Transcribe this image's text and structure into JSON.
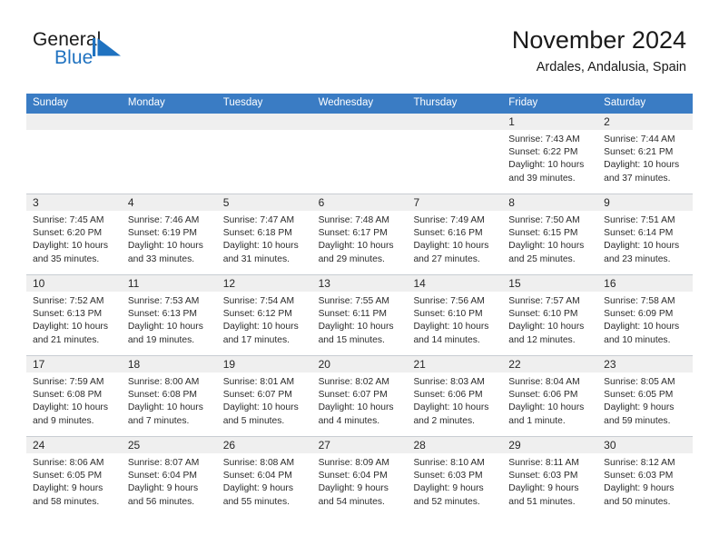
{
  "brand": {
    "line1": "General",
    "line2": "Blue",
    "mark_color": "#1f72c0",
    "text_color": "#1a1a1a",
    "blue_text_color": "#1f72c0"
  },
  "header": {
    "title": "November 2024",
    "subtitle": "Ardales, Andalusia, Spain",
    "accent_color": "#3a7cc4",
    "band_color": "#efefef"
  },
  "weekdays": [
    "Sunday",
    "Monday",
    "Tuesday",
    "Wednesday",
    "Thursday",
    "Friday",
    "Saturday"
  ],
  "labels": {
    "sunrise": "Sunrise:",
    "sunset": "Sunset:",
    "daylight": "Daylight:"
  },
  "weeks": [
    [
      {
        "day": "",
        "sunrise": "",
        "sunset": "",
        "daylight_a": "",
        "daylight_b": "",
        "empty": true
      },
      {
        "day": "",
        "sunrise": "",
        "sunset": "",
        "daylight_a": "",
        "daylight_b": "",
        "empty": true
      },
      {
        "day": "",
        "sunrise": "",
        "sunset": "",
        "daylight_a": "",
        "daylight_b": "",
        "empty": true
      },
      {
        "day": "",
        "sunrise": "",
        "sunset": "",
        "daylight_a": "",
        "daylight_b": "",
        "empty": true
      },
      {
        "day": "",
        "sunrise": "",
        "sunset": "",
        "daylight_a": "",
        "daylight_b": "",
        "empty": true
      },
      {
        "day": "1",
        "sunrise": "Sunrise: 7:43 AM",
        "sunset": "Sunset: 6:22 PM",
        "daylight_a": "Daylight: 10 hours",
        "daylight_b": "and 39 minutes.",
        "empty": false
      },
      {
        "day": "2",
        "sunrise": "Sunrise: 7:44 AM",
        "sunset": "Sunset: 6:21 PM",
        "daylight_a": "Daylight: 10 hours",
        "daylight_b": "and 37 minutes.",
        "empty": false
      }
    ],
    [
      {
        "day": "3",
        "sunrise": "Sunrise: 7:45 AM",
        "sunset": "Sunset: 6:20 PM",
        "daylight_a": "Daylight: 10 hours",
        "daylight_b": "and 35 minutes.",
        "empty": false
      },
      {
        "day": "4",
        "sunrise": "Sunrise: 7:46 AM",
        "sunset": "Sunset: 6:19 PM",
        "daylight_a": "Daylight: 10 hours",
        "daylight_b": "and 33 minutes.",
        "empty": false
      },
      {
        "day": "5",
        "sunrise": "Sunrise: 7:47 AM",
        "sunset": "Sunset: 6:18 PM",
        "daylight_a": "Daylight: 10 hours",
        "daylight_b": "and 31 minutes.",
        "empty": false
      },
      {
        "day": "6",
        "sunrise": "Sunrise: 7:48 AM",
        "sunset": "Sunset: 6:17 PM",
        "daylight_a": "Daylight: 10 hours",
        "daylight_b": "and 29 minutes.",
        "empty": false
      },
      {
        "day": "7",
        "sunrise": "Sunrise: 7:49 AM",
        "sunset": "Sunset: 6:16 PM",
        "daylight_a": "Daylight: 10 hours",
        "daylight_b": "and 27 minutes.",
        "empty": false
      },
      {
        "day": "8",
        "sunrise": "Sunrise: 7:50 AM",
        "sunset": "Sunset: 6:15 PM",
        "daylight_a": "Daylight: 10 hours",
        "daylight_b": "and 25 minutes.",
        "empty": false
      },
      {
        "day": "9",
        "sunrise": "Sunrise: 7:51 AM",
        "sunset": "Sunset: 6:14 PM",
        "daylight_a": "Daylight: 10 hours",
        "daylight_b": "and 23 minutes.",
        "empty": false
      }
    ],
    [
      {
        "day": "10",
        "sunrise": "Sunrise: 7:52 AM",
        "sunset": "Sunset: 6:13 PM",
        "daylight_a": "Daylight: 10 hours",
        "daylight_b": "and 21 minutes.",
        "empty": false
      },
      {
        "day": "11",
        "sunrise": "Sunrise: 7:53 AM",
        "sunset": "Sunset: 6:13 PM",
        "daylight_a": "Daylight: 10 hours",
        "daylight_b": "and 19 minutes.",
        "empty": false
      },
      {
        "day": "12",
        "sunrise": "Sunrise: 7:54 AM",
        "sunset": "Sunset: 6:12 PM",
        "daylight_a": "Daylight: 10 hours",
        "daylight_b": "and 17 minutes.",
        "empty": false
      },
      {
        "day": "13",
        "sunrise": "Sunrise: 7:55 AM",
        "sunset": "Sunset: 6:11 PM",
        "daylight_a": "Daylight: 10 hours",
        "daylight_b": "and 15 minutes.",
        "empty": false
      },
      {
        "day": "14",
        "sunrise": "Sunrise: 7:56 AM",
        "sunset": "Sunset: 6:10 PM",
        "daylight_a": "Daylight: 10 hours",
        "daylight_b": "and 14 minutes.",
        "empty": false
      },
      {
        "day": "15",
        "sunrise": "Sunrise: 7:57 AM",
        "sunset": "Sunset: 6:10 PM",
        "daylight_a": "Daylight: 10 hours",
        "daylight_b": "and 12 minutes.",
        "empty": false
      },
      {
        "day": "16",
        "sunrise": "Sunrise: 7:58 AM",
        "sunset": "Sunset: 6:09 PM",
        "daylight_a": "Daylight: 10 hours",
        "daylight_b": "and 10 minutes.",
        "empty": false
      }
    ],
    [
      {
        "day": "17",
        "sunrise": "Sunrise: 7:59 AM",
        "sunset": "Sunset: 6:08 PM",
        "daylight_a": "Daylight: 10 hours",
        "daylight_b": "and 9 minutes.",
        "empty": false
      },
      {
        "day": "18",
        "sunrise": "Sunrise: 8:00 AM",
        "sunset": "Sunset: 6:08 PM",
        "daylight_a": "Daylight: 10 hours",
        "daylight_b": "and 7 minutes.",
        "empty": false
      },
      {
        "day": "19",
        "sunrise": "Sunrise: 8:01 AM",
        "sunset": "Sunset: 6:07 PM",
        "daylight_a": "Daylight: 10 hours",
        "daylight_b": "and 5 minutes.",
        "empty": false
      },
      {
        "day": "20",
        "sunrise": "Sunrise: 8:02 AM",
        "sunset": "Sunset: 6:07 PM",
        "daylight_a": "Daylight: 10 hours",
        "daylight_b": "and 4 minutes.",
        "empty": false
      },
      {
        "day": "21",
        "sunrise": "Sunrise: 8:03 AM",
        "sunset": "Sunset: 6:06 PM",
        "daylight_a": "Daylight: 10 hours",
        "daylight_b": "and 2 minutes.",
        "empty": false
      },
      {
        "day": "22",
        "sunrise": "Sunrise: 8:04 AM",
        "sunset": "Sunset: 6:06 PM",
        "daylight_a": "Daylight: 10 hours",
        "daylight_b": "and 1 minute.",
        "empty": false
      },
      {
        "day": "23",
        "sunrise": "Sunrise: 8:05 AM",
        "sunset": "Sunset: 6:05 PM",
        "daylight_a": "Daylight: 9 hours",
        "daylight_b": "and 59 minutes.",
        "empty": false
      }
    ],
    [
      {
        "day": "24",
        "sunrise": "Sunrise: 8:06 AM",
        "sunset": "Sunset: 6:05 PM",
        "daylight_a": "Daylight: 9 hours",
        "daylight_b": "and 58 minutes.",
        "empty": false
      },
      {
        "day": "25",
        "sunrise": "Sunrise: 8:07 AM",
        "sunset": "Sunset: 6:04 PM",
        "daylight_a": "Daylight: 9 hours",
        "daylight_b": "and 56 minutes.",
        "empty": false
      },
      {
        "day": "26",
        "sunrise": "Sunrise: 8:08 AM",
        "sunset": "Sunset: 6:04 PM",
        "daylight_a": "Daylight: 9 hours",
        "daylight_b": "and 55 minutes.",
        "empty": false
      },
      {
        "day": "27",
        "sunrise": "Sunrise: 8:09 AM",
        "sunset": "Sunset: 6:04 PM",
        "daylight_a": "Daylight: 9 hours",
        "daylight_b": "and 54 minutes.",
        "empty": false
      },
      {
        "day": "28",
        "sunrise": "Sunrise: 8:10 AM",
        "sunset": "Sunset: 6:03 PM",
        "daylight_a": "Daylight: 9 hours",
        "daylight_b": "and 52 minutes.",
        "empty": false
      },
      {
        "day": "29",
        "sunrise": "Sunrise: 8:11 AM",
        "sunset": "Sunset: 6:03 PM",
        "daylight_a": "Daylight: 9 hours",
        "daylight_b": "and 51 minutes.",
        "empty": false
      },
      {
        "day": "30",
        "sunrise": "Sunrise: 8:12 AM",
        "sunset": "Sunset: 6:03 PM",
        "daylight_a": "Daylight: 9 hours",
        "daylight_b": "and 50 minutes.",
        "empty": false
      }
    ]
  ]
}
